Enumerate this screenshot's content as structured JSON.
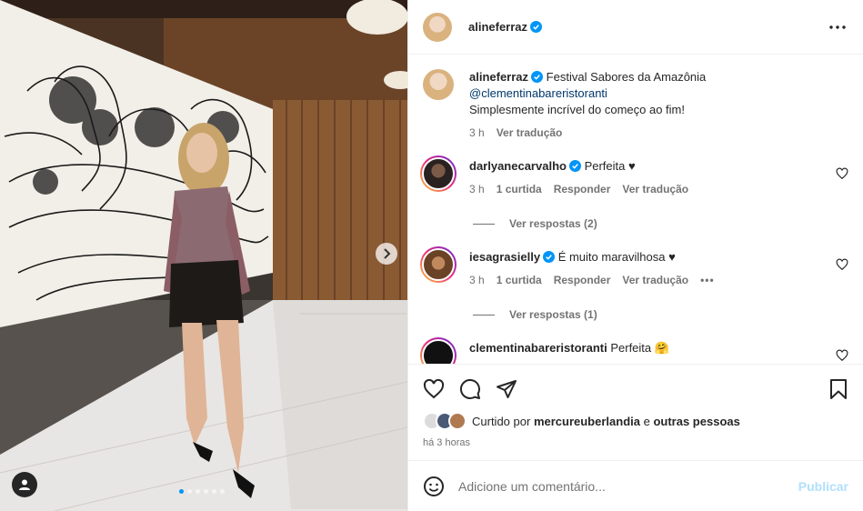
{
  "post": {
    "author": "alineferraz",
    "caption_text": "Festival Sabores da Amazônia",
    "caption_mention": "@clementinabareristoranti",
    "caption_line2": "Simplesmente incrível do começo ao fim!",
    "caption_time": "3 h",
    "caption_translate": "Ver tradução"
  },
  "comments": [
    {
      "user": "darlyanecarvalho",
      "verified": true,
      "text": "Perfeita ♥",
      "time": "3 h",
      "likes": "1 curtida",
      "reply": "Responder",
      "translate": "Ver tradução",
      "replies": "Ver respostas (2)"
    },
    {
      "user": "iesagrasielly",
      "verified": true,
      "text": "É muito maravilhosa ♥",
      "time": "3 h",
      "likes": "1 curtida",
      "reply": "Responder",
      "translate": "Ver tradução",
      "more": "•••",
      "replies": "Ver respostas (1)"
    },
    {
      "user": "clementinabareristoranti",
      "verified": false,
      "text": "Perfeita 🤗"
    }
  ],
  "likes": {
    "prefix": "Curtido por",
    "user": "mercureuberlandia",
    "joiner": "e",
    "others": "outras pessoas"
  },
  "timestamp": "há 3 horas",
  "add_comment": {
    "placeholder": "Adicione um comentário...",
    "publish": "Publicar"
  },
  "carousel": {
    "count": 6,
    "active": 0
  },
  "colors": {
    "accent": "#0095f6",
    "verified": "#0095f6",
    "publish_disabled": "#b2dffc"
  },
  "icons": [
    "more-icon",
    "heart-icon",
    "comment-icon",
    "share-icon",
    "bookmark-icon",
    "emoji-icon",
    "chevron-right-icon",
    "user-tag-icon",
    "verified-icon"
  ]
}
